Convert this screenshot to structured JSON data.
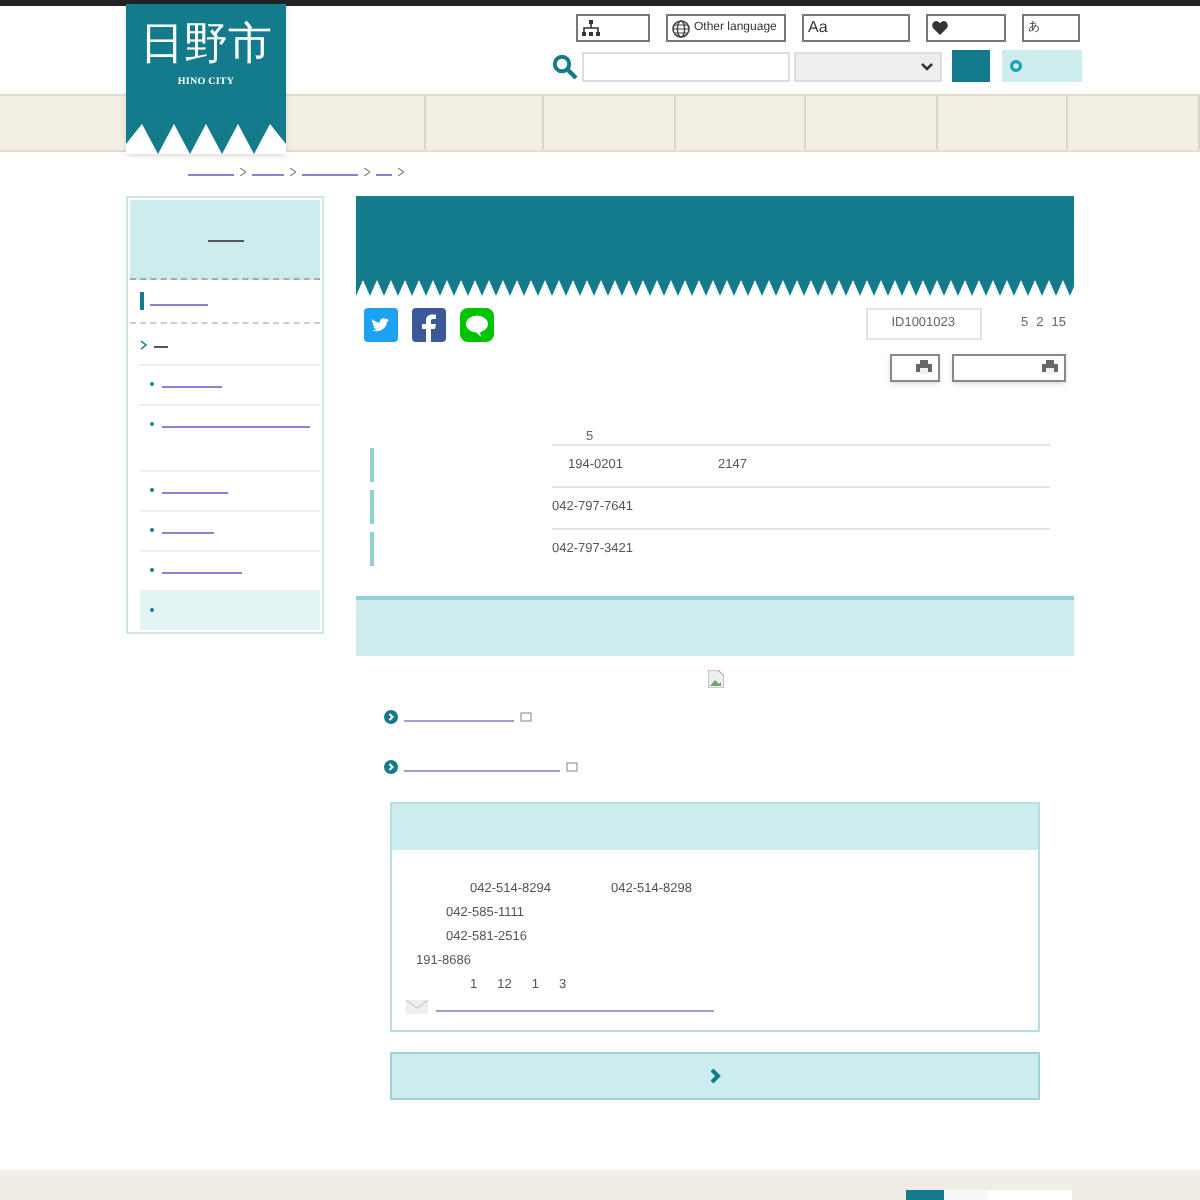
{
  "header": {
    "logo_title": "日野市",
    "logo_subtitle": "HINO CITY",
    "tools": [
      {
        "kind": "sitemap"
      },
      {
        "kind": "language",
        "label": "Other language"
      },
      {
        "kind": "font",
        "label": "Aa"
      },
      {
        "kind": "favorite"
      },
      {
        "kind": "reading",
        "label": "あ"
      }
    ]
  },
  "sidebar": {
    "items": [
      {
        "selected": false
      },
      {
        "selected": false
      },
      {
        "selected": false
      },
      {
        "selected": false
      },
      {
        "selected": false
      },
      {
        "selected": true
      }
    ]
  },
  "article": {
    "page_id": "ID1001023",
    "updated": [
      "5",
      "2",
      "15"
    ],
    "intro": "5",
    "rows": [
      {
        "cells": [
          "194-0201",
          "2147"
        ]
      },
      {
        "cells": [
          "042-797-7641"
        ]
      },
      {
        "cells": [
          "042-797-3421"
        ]
      }
    ],
    "contact": {
      "lines": [
        [
          "042-514-8294",
          "042-514-8298"
        ],
        [
          "042-585-1111"
        ],
        [
          "042-581-2516"
        ],
        [
          "191-8686"
        ],
        [
          "1",
          "12",
          "1",
          "3"
        ]
      ]
    }
  }
}
